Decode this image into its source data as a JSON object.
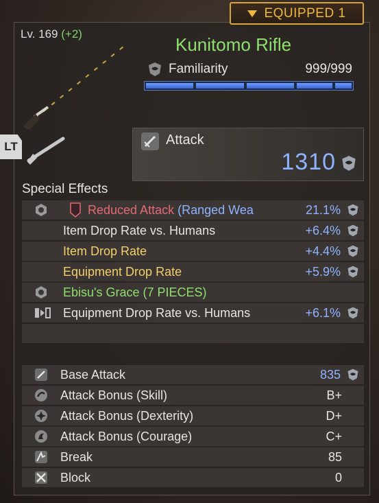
{
  "equipped_label": "EQUIPPED 1",
  "weapon": {
    "level": "Lv. 169",
    "level_bonus": "(+2)",
    "name": "Kunitomo Rifle",
    "familiarity_label": "Familiarity",
    "familiarity_value": "999/999",
    "familiarity_fraction": 1.0,
    "attack_label": "Attack",
    "attack_value": "1310"
  },
  "lt_label": "LT",
  "special_effects_title": "Special Effects",
  "effects": [
    {
      "name_a": "Reduced Attack",
      "name_b": "(Ranged Wea",
      "value": "21.1%"
    },
    {
      "name": "Item Drop Rate vs. Humans",
      "value": "+6.4%"
    },
    {
      "name": "Item Drop Rate",
      "value": "+4.4%"
    },
    {
      "name": "Equipment Drop Rate",
      "value": "+5.9%"
    },
    {
      "name": "Ebisu's Grace (7 PIECES)",
      "value": ""
    },
    {
      "name": "Equipment Drop Rate vs. Humans",
      "value": "+6.1%"
    }
  ],
  "stats": [
    {
      "name": "Base Attack",
      "value": "835"
    },
    {
      "name": "Attack Bonus (Skill)",
      "value": "B+"
    },
    {
      "name": "Attack Bonus (Dexterity)",
      "value": "D+"
    },
    {
      "name": "Attack Bonus (Courage)",
      "value": "C+"
    },
    {
      "name": "Break",
      "value": "85"
    },
    {
      "name": "Block",
      "value": "0"
    }
  ],
  "colors": {
    "effect_green": "#8ee06e",
    "effect_yellow": "#f2cf6a",
    "effect_red": "#e36a73",
    "value_blue": "#8eb4ff",
    "equipped_gold": "#f0b53e"
  }
}
